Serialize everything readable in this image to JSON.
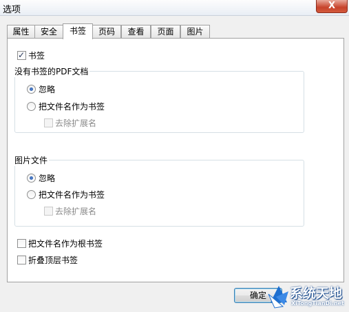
{
  "window": {
    "title": "选项",
    "close_glyph": "X"
  },
  "tabs": [
    {
      "label": "属性"
    },
    {
      "label": "安全"
    },
    {
      "label": "书签",
      "active": true
    },
    {
      "label": "页码"
    },
    {
      "label": "查看"
    },
    {
      "label": "页面"
    },
    {
      "label": "图片"
    }
  ],
  "bookmark_enable": {
    "label": "书签",
    "checked": true
  },
  "pdf_group": {
    "legend": "没有书签的PDF文档",
    "opt_ignore": {
      "label": "忽略",
      "checked": true
    },
    "opt_filename": {
      "label": "把文件名作为书签",
      "checked": false
    },
    "strip_ext": {
      "label": "去除扩展名",
      "checked": false,
      "disabled": true
    }
  },
  "image_group": {
    "legend": "图片文件",
    "opt_ignore": {
      "label": "忽略",
      "checked": true
    },
    "opt_filename": {
      "label": "把文件名作为书签",
      "checked": false
    },
    "strip_ext": {
      "label": "去除扩展名",
      "checked": false,
      "disabled": true
    }
  },
  "root_bookmark": {
    "label": "把文件名作为根书签",
    "checked": false
  },
  "collapse_top": {
    "label": "折叠顶层书签",
    "checked": false
  },
  "buttons": {
    "ok": "确定"
  },
  "watermark": {
    "title": "系统天地",
    "subtitle": "XiTongTianDi.net"
  },
  "colors": {
    "accent": "#3c7fb1",
    "radio_dot": "#1d4f9e",
    "logo_blue": "#0a3f86"
  }
}
